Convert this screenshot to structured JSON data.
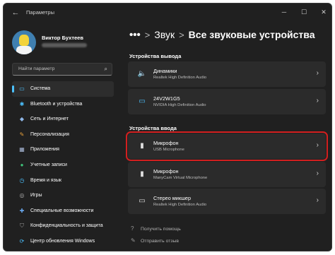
{
  "window": {
    "title": "Параметры",
    "back_icon": "←",
    "controls": {
      "minimize": "─",
      "maximize": "☐",
      "close": "✕"
    }
  },
  "user": {
    "name": "Виктор Бухтеев"
  },
  "search": {
    "placeholder": "Найти параметр",
    "icon": "⌕"
  },
  "nav": {
    "items": [
      {
        "label": "Система",
        "icon": "▭",
        "color": "#4cc2ff",
        "active": true
      },
      {
        "label": "Bluetooth и устройства",
        "icon": "✱",
        "color": "#4cc2ff"
      },
      {
        "label": "Сеть и Интернет",
        "icon": "◆",
        "color": "#8fb7e8"
      },
      {
        "label": "Персонализация",
        "icon": "✎",
        "color": "#e9a23b"
      },
      {
        "label": "Приложения",
        "icon": "▦",
        "color": "#a9b9d8"
      },
      {
        "label": "Учетные записи",
        "icon": "●",
        "color": "#3fc27a"
      },
      {
        "label": "Время и язык",
        "icon": "◷",
        "color": "#4cc2ff"
      },
      {
        "label": "Игры",
        "icon": "◎",
        "color": "#b0b0b0"
      },
      {
        "label": "Специальные возможности",
        "icon": "✚",
        "color": "#6aa9f0"
      },
      {
        "label": "Конфиденциальность и защита",
        "icon": "⛉",
        "color": "#9a9a9a"
      },
      {
        "label": "Центр обновления Windows",
        "icon": "⟳",
        "color": "#4cc2ff"
      }
    ]
  },
  "breadcrumb": {
    "dots": "•••",
    "sep": ">",
    "parent": "Звук",
    "current": "Все звуковые устройства"
  },
  "output": {
    "title": "Устройства вывода",
    "devices": [
      {
        "name": "Динамики",
        "sub": "Realtek High Definition Audio",
        "icon": "🔈"
      },
      {
        "name": "24V2W1G5",
        "sub": "NVIDIA High Definition Audio",
        "icon": "▭"
      }
    ]
  },
  "input": {
    "title": "Устройства ввода",
    "devices": [
      {
        "name": "Микрофон",
        "sub": "USB Microphone",
        "icon": "▮",
        "highlighted": true
      },
      {
        "name": "Микрофон",
        "sub": "ManyCam Virtual Microphone",
        "icon": "▮"
      },
      {
        "name": "Стерео микшер",
        "sub": "Realtek High Definition Audio",
        "icon": "▭"
      }
    ]
  },
  "chevron": "›",
  "help": {
    "get_help": {
      "label": "Получить помощь",
      "icon": "?"
    },
    "feedback": {
      "label": "Отправить отзыв",
      "icon": "✎"
    }
  },
  "colors": {
    "accent": "#4cc2ff",
    "highlight": "#d21f1f",
    "background": "#202020",
    "card": "#2b2b2b"
  }
}
